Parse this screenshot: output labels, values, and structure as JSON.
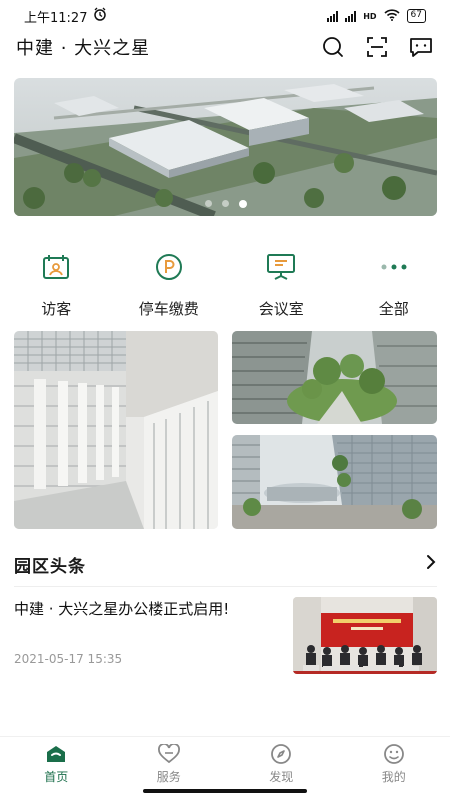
{
  "status_bar": {
    "time": "上午11:27",
    "network_label": "HD",
    "battery": "67"
  },
  "header": {
    "title": "中建 · 大兴之星",
    "icons": [
      "search-icon",
      "scan-icon",
      "message-icon"
    ]
  },
  "banner": {
    "slide_count": 3,
    "active_slide": 3
  },
  "quick_menu": [
    {
      "label": "访客",
      "icon": "visitor-icon"
    },
    {
      "label": "停车缴费",
      "icon": "parking-icon"
    },
    {
      "label": "会议室",
      "icon": "meeting-room-icon"
    },
    {
      "label": "全部",
      "icon": "more-dots-icon"
    }
  ],
  "news_section": {
    "title": "园区头条",
    "items": [
      {
        "headline": "中建 · 大兴之星办公楼正式启用!",
        "date": "2021-05-17 15:35"
      }
    ]
  },
  "tabbar": [
    {
      "label": "首页",
      "icon": "home-icon",
      "active": true
    },
    {
      "label": "服务",
      "icon": "heart-icon",
      "active": false
    },
    {
      "label": "发现",
      "icon": "compass-icon",
      "active": false
    },
    {
      "label": "我的",
      "icon": "profile-icon",
      "active": false
    }
  ],
  "colors": {
    "accent": "#1a6e4a",
    "icon_green": "#1f7a55",
    "inactive": "#888888"
  }
}
